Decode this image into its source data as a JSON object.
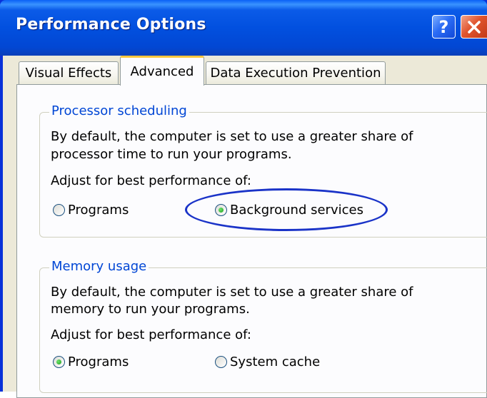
{
  "window": {
    "title": "Performance Options",
    "help_icon": "?",
    "close_icon": "close-x"
  },
  "tabs": [
    {
      "label": "Visual Effects",
      "selected": false
    },
    {
      "label": "Advanced",
      "selected": true
    },
    {
      "label": "Data Execution Prevention",
      "selected": false
    }
  ],
  "processor": {
    "legend": "Processor scheduling",
    "desc_line1": "By default, the computer is set to use a greater share of",
    "desc_line2": "processor time to run your programs.",
    "adjust": "Adjust for best performance of:",
    "options": [
      {
        "label": "Programs",
        "checked": false
      },
      {
        "label": "Background services",
        "checked": true
      }
    ],
    "highlight_color": "#1a33c8"
  },
  "memory": {
    "legend": "Memory usage",
    "desc_line1": "By default, the computer is set to use a greater share of",
    "desc_line2": "memory to run your programs.",
    "adjust": "Adjust for best performance of:",
    "options": [
      {
        "label": "Programs",
        "checked": true
      },
      {
        "label": "System cache",
        "checked": false
      }
    ]
  },
  "colors": {
    "titlebar": "#0250df",
    "legend_text": "#0046d5",
    "dialog_face": "#ece9d8",
    "selected_tab_accent": "#ffc73c",
    "close_button": "#e1542e"
  }
}
